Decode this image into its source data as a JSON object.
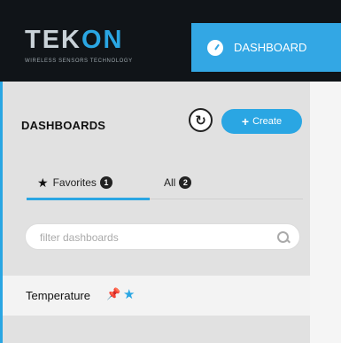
{
  "brand": {
    "name_part1": "TEK",
    "name_part2": "ON",
    "tagline": "WIRELESS SENSORS TECHNOLOGY"
  },
  "topnav": {
    "dashboard_label": "DASHBOARD"
  },
  "sidebar": {
    "title": "DASHBOARDS",
    "refresh_icon": "refresh-icon",
    "create_label": "Create",
    "tabs": [
      {
        "label": "Favorites",
        "count": "1"
      },
      {
        "label": "All",
        "count": "2"
      }
    ],
    "search": {
      "placeholder": "filter dashboards"
    },
    "items": [
      {
        "label": "Temperature"
      }
    ]
  },
  "colors": {
    "accent": "#2aa6e3",
    "topbar": "#101418",
    "sidebar_bg": "#e1e1e1"
  }
}
